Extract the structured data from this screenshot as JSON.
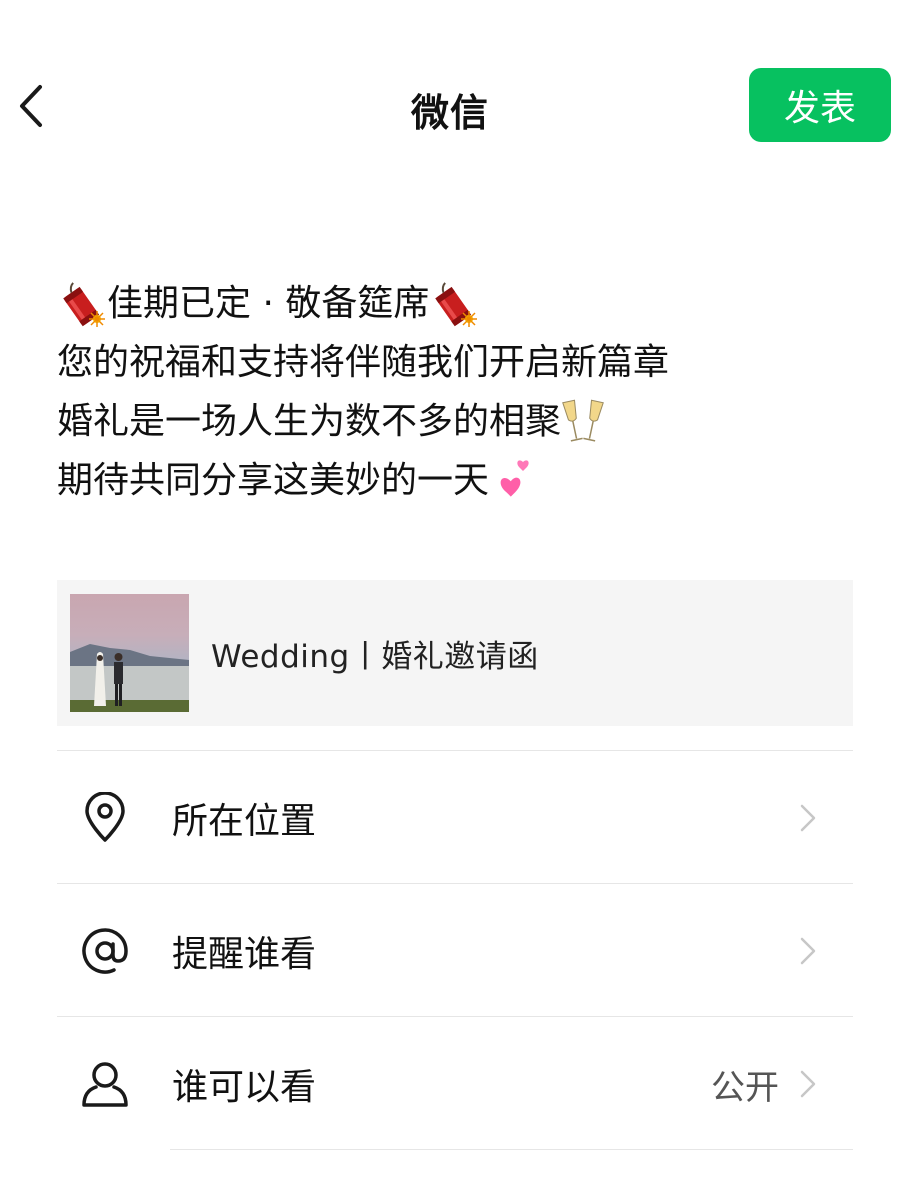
{
  "header": {
    "title": "微信",
    "publish_label": "发表"
  },
  "post": {
    "lines": [
      "佳期已定 · 敬备筵席",
      "您的祝福和支持将伴随我们开启新篇章",
      "婚礼是一场人生为数不多的相聚",
      "期待共同分享这美妙的一天"
    ]
  },
  "link_card": {
    "title": "Wedding丨婚礼邀请函"
  },
  "menu": {
    "location": {
      "label": "所在位置",
      "icon": "location-pin-icon"
    },
    "mention": {
      "label": "提醒谁看",
      "icon": "at-icon"
    },
    "visibility": {
      "label": "谁可以看",
      "value": "公开",
      "icon": "person-icon"
    }
  },
  "colors": {
    "publish_green": "#07c160",
    "card_bg": "#f5f5f5",
    "divider": "#e6e6e6"
  }
}
